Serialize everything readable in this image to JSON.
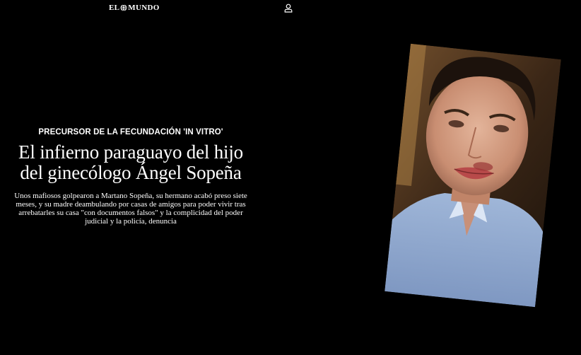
{
  "header": {
    "logo_left": "EL",
    "logo_right": "MUNDO",
    "logo_icon": "globe-icon",
    "user_icon": "user-icon"
  },
  "article": {
    "kicker": "PRECURSOR DE LA FECUNDACIÓN 'IN VITRO'",
    "title_lines": [
      "El infierno paraguayo del hijo",
      "del ginecólogo Ángel Sopeña"
    ],
    "standfirst_lines": [
      "Unos mafiosos golpearon a Martano Sopeña, su hermano acabó preso siete",
      "meses, y su madre deambulando por casas de amigos para poder vivir tras",
      "arrebatarles su casa \"con documentos falsos\" y la complicidad del poder",
      "judicial y la policía, denuncia"
    ]
  },
  "photo": {
    "subject": "bruised-face-photo"
  },
  "colors": {
    "background": "#000000",
    "text": "#ffffff"
  }
}
